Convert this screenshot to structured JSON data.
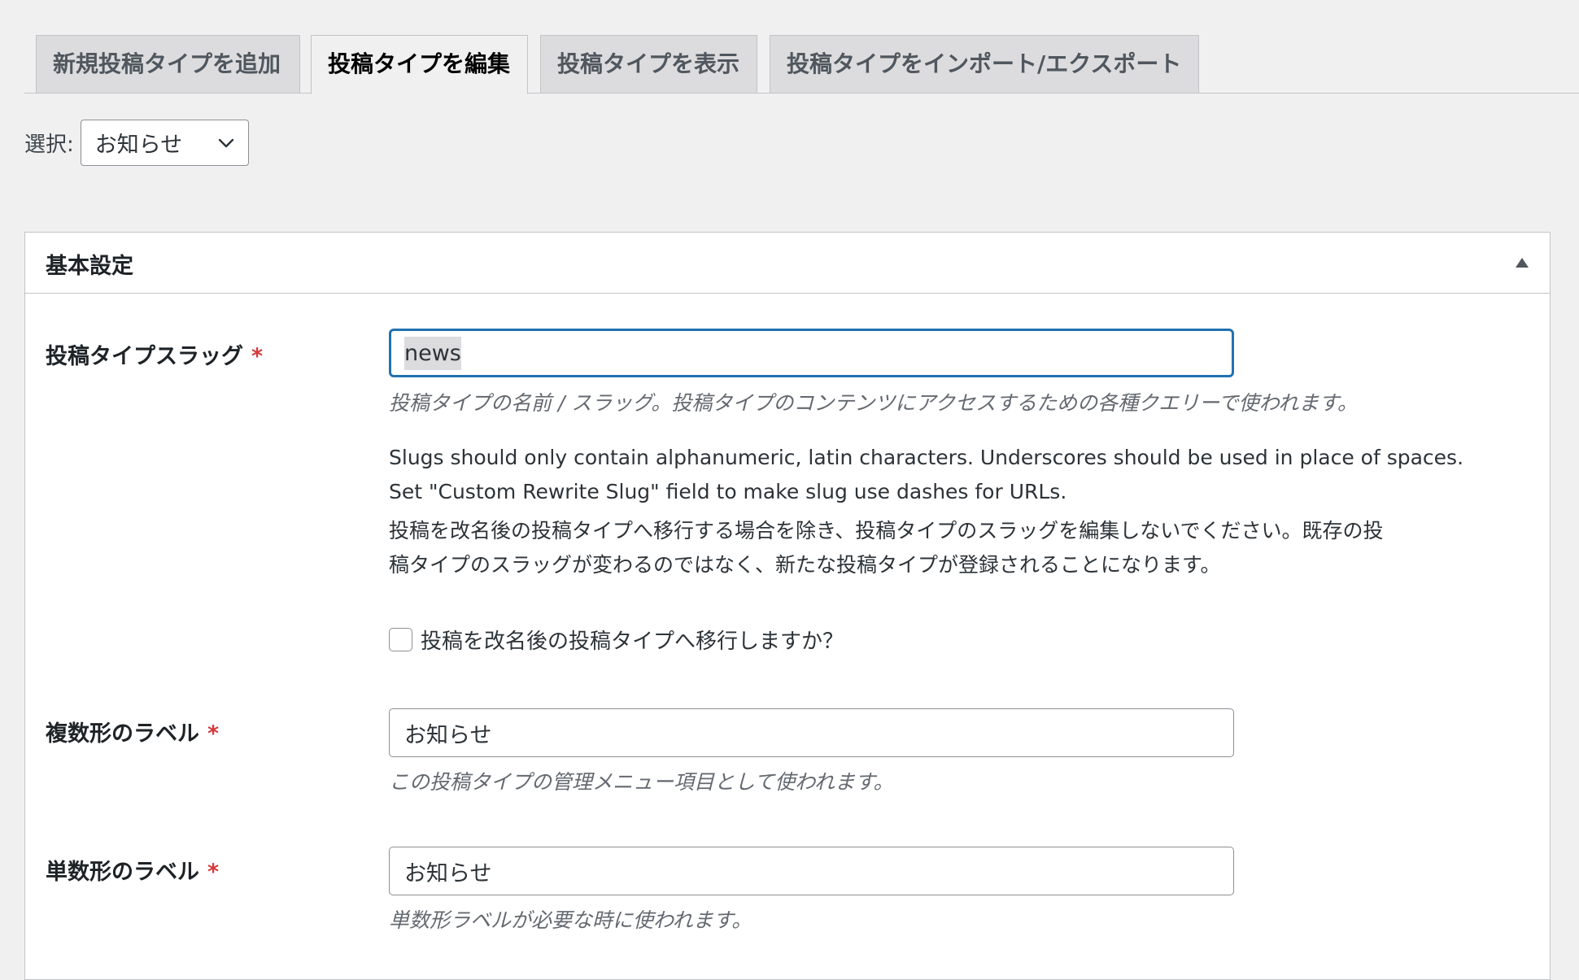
{
  "tabs": [
    {
      "label": "新規投稿タイプを追加",
      "active": false
    },
    {
      "label": "投稿タイプを編集",
      "active": true
    },
    {
      "label": "投稿タイプを表示",
      "active": false
    },
    {
      "label": "投稿タイプをインポート/エクスポート",
      "active": false
    }
  ],
  "select": {
    "label": "選択:",
    "value": "お知らせ"
  },
  "panel": {
    "title": "基本設定"
  },
  "fields": {
    "slug": {
      "label": "投稿タイプスラッグ",
      "required": "*",
      "value": "news",
      "description": "投稿タイプの名前 / スラッグ。投稿タイプのコンテンツにアクセスするための各種クエリーで使われます。",
      "help_en_line1": "Slugs should only contain alphanumeric, latin characters. Underscores should be used in place of spaces.",
      "help_en_line2": "Set \"Custom Rewrite Slug\" field to make slug use dashes for URLs.",
      "help_ja_line1": "投稿を改名後の投稿タイプへ移行する場合を除き、投稿タイプのスラッグを編集しないでください。既存の投",
      "help_ja_line2": "稿タイプのスラッグが変わるのではなく、新たな投稿タイプが登録されることになります。",
      "migrate_checkbox_label": "投稿を改名後の投稿タイプへ移行しますか？"
    },
    "plural": {
      "label": "複数形のラベル",
      "required": "*",
      "value": "お知らせ",
      "description": "この投稿タイプの管理メニュー項目として使われます。"
    },
    "singular": {
      "label": "単数形のラベル",
      "required": "*",
      "value": "お知らせ",
      "description": "単数形ラベルが必要な時に使われます。"
    }
  }
}
